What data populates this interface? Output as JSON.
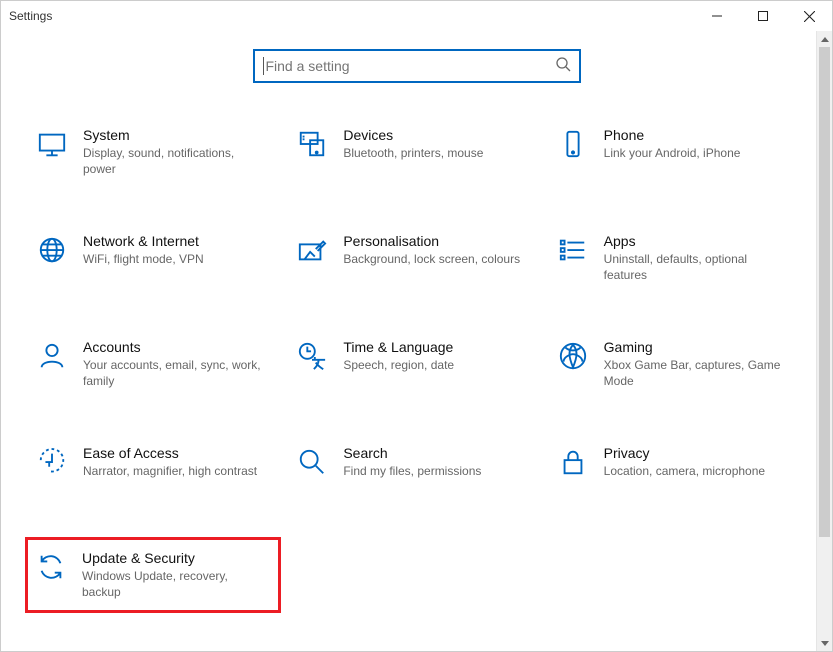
{
  "window": {
    "title": "Settings"
  },
  "search": {
    "placeholder": "Find a setting"
  },
  "tiles": {
    "system": {
      "title": "System",
      "desc": "Display, sound, notifications, power"
    },
    "devices": {
      "title": "Devices",
      "desc": "Bluetooth, printers, mouse"
    },
    "phone": {
      "title": "Phone",
      "desc": "Link your Android, iPhone"
    },
    "network": {
      "title": "Network & Internet",
      "desc": "WiFi, flight mode, VPN"
    },
    "personal": {
      "title": "Personalisation",
      "desc": "Background, lock screen, colours"
    },
    "apps": {
      "title": "Apps",
      "desc": "Uninstall, defaults, optional features"
    },
    "accounts": {
      "title": "Accounts",
      "desc": "Your accounts, email, sync, work, family"
    },
    "time": {
      "title": "Time & Language",
      "desc": "Speech, region, date"
    },
    "gaming": {
      "title": "Gaming",
      "desc": "Xbox Game Bar, captures, Game Mode"
    },
    "ease": {
      "title": "Ease of Access",
      "desc": "Narrator, magnifier, high contrast"
    },
    "searchcat": {
      "title": "Search",
      "desc": "Find my files, permissions"
    },
    "privacy": {
      "title": "Privacy",
      "desc": "Location, camera, microphone"
    },
    "update": {
      "title": "Update & Security",
      "desc": "Windows Update, recovery, backup"
    }
  }
}
